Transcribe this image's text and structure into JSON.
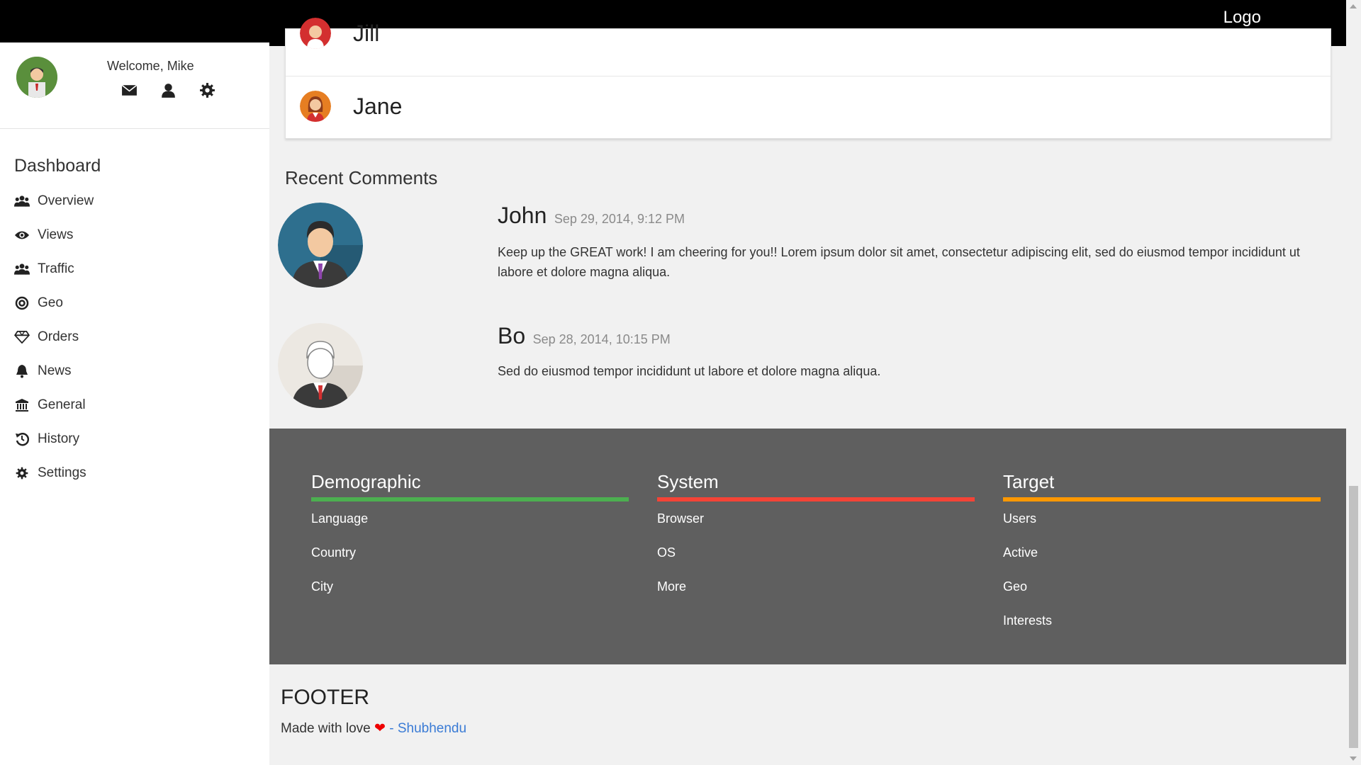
{
  "header": {
    "logo": "Logo"
  },
  "sidebar": {
    "welcome": "Welcome, Mike",
    "dashboard_title": "Dashboard",
    "items": [
      {
        "label": "Overview",
        "icon": "users-icon"
      },
      {
        "label": "Views",
        "icon": "eye-icon"
      },
      {
        "label": "Traffic",
        "icon": "users-icon"
      },
      {
        "label": "Geo",
        "icon": "target-icon"
      },
      {
        "label": "Orders",
        "icon": "diamond-icon"
      },
      {
        "label": "News",
        "icon": "bell-icon"
      },
      {
        "label": "General",
        "icon": "bank-icon"
      },
      {
        "label": "History",
        "icon": "history-icon"
      },
      {
        "label": "Settings",
        "icon": "gear-icon"
      }
    ]
  },
  "people": [
    {
      "name": "Jill"
    },
    {
      "name": "Jane"
    }
  ],
  "comments": {
    "title": "Recent Comments",
    "items": [
      {
        "author": "John",
        "date": "Sep 29, 2014, 9:12 PM",
        "text": "Keep up the GREAT work! I am cheering for you!! Lorem ipsum dolor sit amet, consectetur adipiscing elit, sed do eiusmod tempor incididunt ut labore et dolore magna aliqua."
      },
      {
        "author": "Bo",
        "date": "Sep 28, 2014, 10:15 PM",
        "text": "Sed do eiusmod tempor incididunt ut labore et dolore magna aliqua."
      }
    ]
  },
  "links": {
    "columns": [
      {
        "title": "Demographic",
        "color": "#4caf50",
        "items": [
          "Language",
          "Country",
          "City"
        ]
      },
      {
        "title": "System",
        "color": "#f44336",
        "items": [
          "Browser",
          "OS",
          "More"
        ]
      },
      {
        "title": "Target",
        "color": "#ff9800",
        "items": [
          "Users",
          "Active",
          "Geo",
          "Interests"
        ]
      }
    ]
  },
  "footer": {
    "title": "FOOTER",
    "text": "Made with love",
    "separator": " - ",
    "link": "Shubhendu"
  }
}
